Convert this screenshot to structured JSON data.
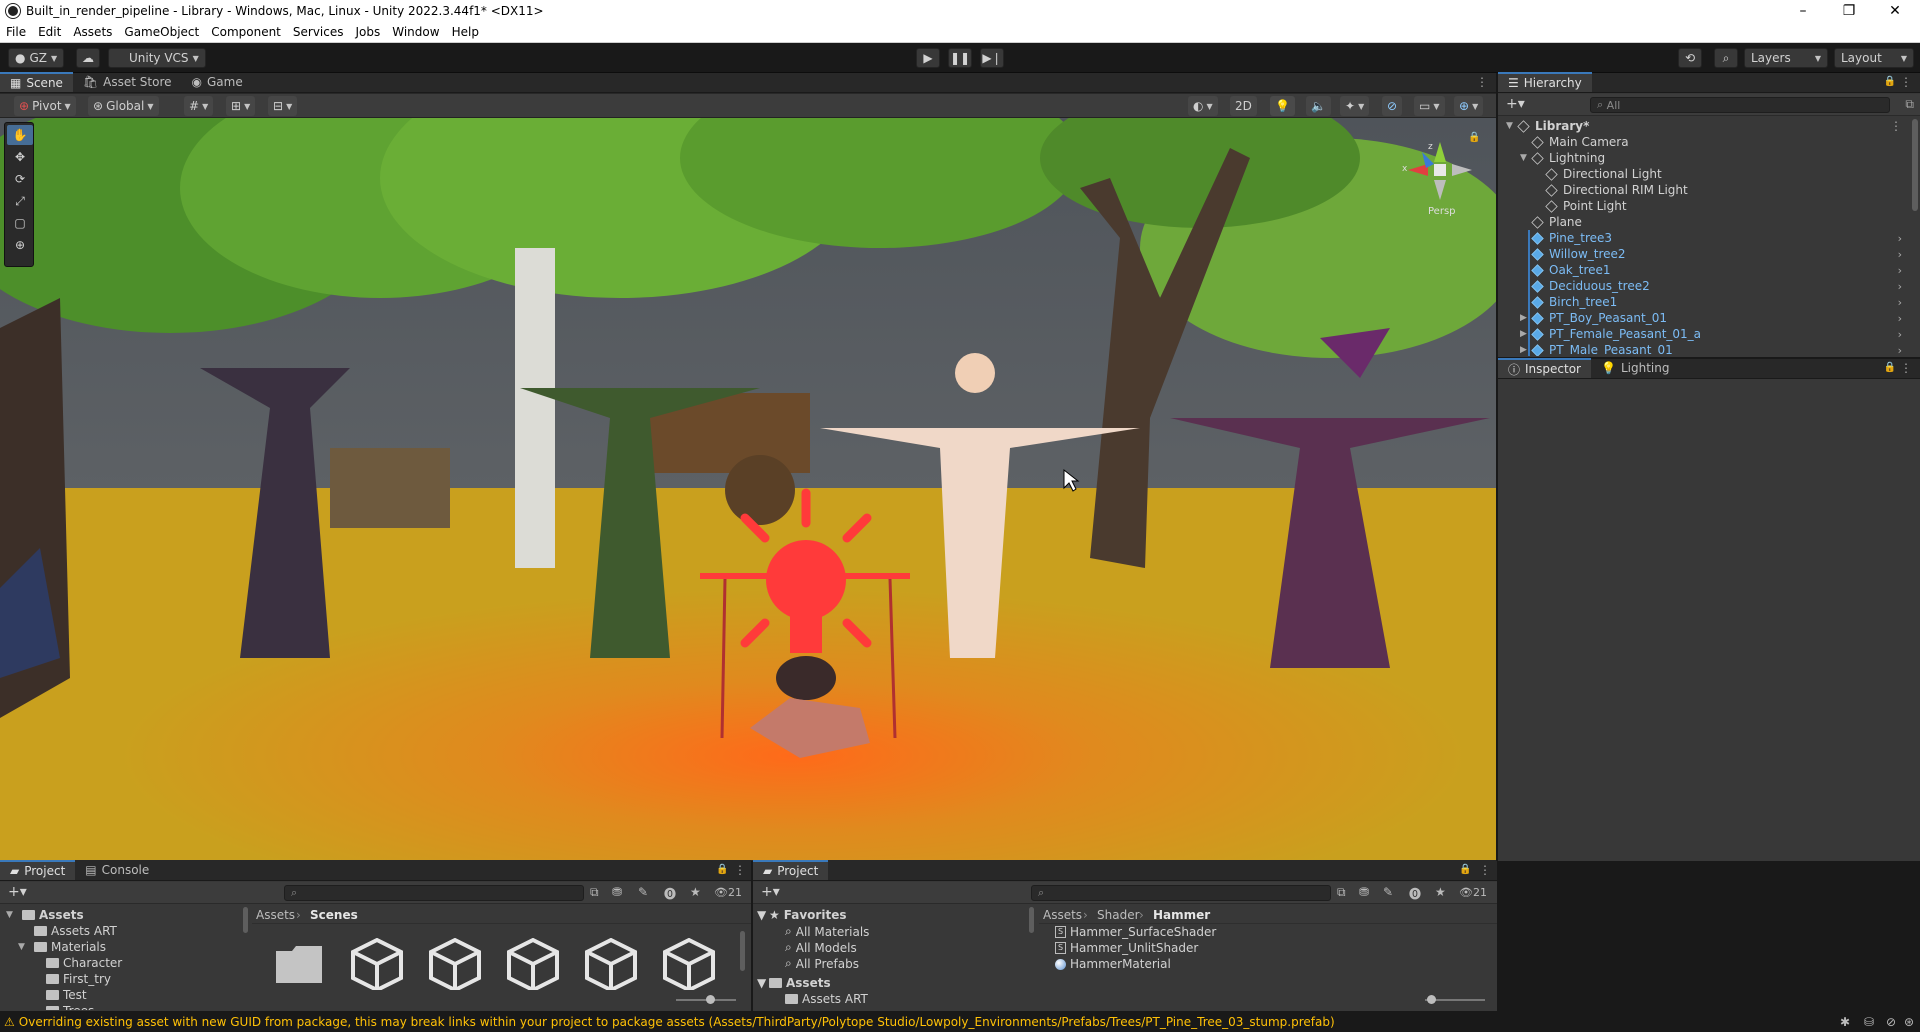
{
  "window": {
    "title": "Built_in_render_pipeline - Library - Windows, Mac, Linux - Unity 2022.3.44f1* <DX11>",
    "minimize": "–",
    "maximize": "❐",
    "close": "✕"
  },
  "menu": [
    "File",
    "Edit",
    "Assets",
    "GameObject",
    "Component",
    "Services",
    "Jobs",
    "Window",
    "Help"
  ],
  "toolbar": {
    "account": "GZ",
    "vcs": "Unity VCS",
    "layers": "Layers",
    "layout": "Layout"
  },
  "scene_tabs": [
    {
      "label": "Scene",
      "icon": "scene-icon"
    },
    {
      "label": "Asset Store",
      "icon": "store-icon"
    },
    {
      "label": "Game",
      "icon": "game-icon"
    }
  ],
  "scene_toolbar": {
    "pivot": "Pivot",
    "global": "Global",
    "mode_2d": "2D"
  },
  "gizmo": {
    "label": "Persp",
    "x": "x",
    "z": "z"
  },
  "hierarchy": {
    "tab": "Hierarchy",
    "search_placeholder": "All",
    "items": [
      {
        "label": "Library*",
        "depth": 0,
        "bold": true,
        "prefab": false,
        "expander": "open"
      },
      {
        "label": "Main Camera",
        "depth": 1,
        "prefab": false,
        "expander": ""
      },
      {
        "label": "Lightning",
        "depth": 1,
        "prefab": false,
        "expander": "open"
      },
      {
        "label": "Directional Light",
        "depth": 2,
        "prefab": false,
        "expander": ""
      },
      {
        "label": "Directional RIM Light",
        "depth": 2,
        "prefab": false,
        "expander": ""
      },
      {
        "label": "Point Light",
        "depth": 2,
        "prefab": false,
        "expander": ""
      },
      {
        "label": "Plane",
        "depth": 1,
        "prefab": false,
        "expander": ""
      },
      {
        "label": "Pine_tree3",
        "depth": 1,
        "prefab": true,
        "expander": ""
      },
      {
        "label": "Willow_tree2",
        "depth": 1,
        "prefab": true,
        "expander": ""
      },
      {
        "label": "Oak_tree1",
        "depth": 1,
        "prefab": true,
        "expander": ""
      },
      {
        "label": "Deciduous_tree2",
        "depth": 1,
        "prefab": true,
        "expander": ""
      },
      {
        "label": "Birch_tree1",
        "depth": 1,
        "prefab": true,
        "expander": ""
      },
      {
        "label": "PT_Boy_Peasant_01",
        "depth": 1,
        "prefab": true,
        "expander": "closed"
      },
      {
        "label": "PT_Female_Peasant_01_a",
        "depth": 1,
        "prefab": true,
        "expander": "closed"
      },
      {
        "label": "PT_Male_Peasant_01",
        "depth": 1,
        "prefab": true,
        "expander": "closed"
      }
    ]
  },
  "inspector_tabs": [
    {
      "label": "Inspector",
      "icon": "info-icon"
    },
    {
      "label": "Lighting",
      "icon": "bulb-icon"
    }
  ],
  "project_left": {
    "tabs": [
      {
        "label": "Project",
        "icon": "folder-icon"
      },
      {
        "label": "Console",
        "icon": "console-icon"
      }
    ],
    "count": "21",
    "tree": [
      {
        "label": "Assets",
        "depth": 0,
        "bold": true,
        "expander": "open"
      },
      {
        "label": "Assets ART",
        "depth": 1,
        "bold": false,
        "expander": ""
      },
      {
        "label": "Materials",
        "depth": 1,
        "bold": false,
        "expander": "open"
      },
      {
        "label": "Character",
        "depth": 2,
        "bold": false,
        "expander": ""
      },
      {
        "label": "First_try",
        "depth": 2,
        "bold": false,
        "expander": ""
      },
      {
        "label": "Test",
        "depth": 2,
        "bold": false,
        "expander": ""
      },
      {
        "label": "Trees",
        "depth": 2,
        "bold": false,
        "expander": ""
      }
    ],
    "breadcrumb": [
      "Assets",
      "Scenes"
    ]
  },
  "project_right": {
    "tab": "Project",
    "count": "21",
    "favorites": {
      "label": "Favorites",
      "items": [
        "All Materials",
        "All Models",
        "All Prefabs"
      ]
    },
    "assets_tree": [
      "Assets",
      "Assets ART"
    ],
    "breadcrumb": [
      "Assets",
      "Shader",
      "Hammer"
    ],
    "files": [
      {
        "label": "Hammer_SurfaceShader",
        "icon": "shader-icon"
      },
      {
        "label": "Hammer_UnlitShader",
        "icon": "shader-icon"
      },
      {
        "label": "HammerMaterial",
        "icon": "material-icon"
      }
    ]
  },
  "status": {
    "message": "Overriding existing asset with new GUID from package, this may break links within your project to package assets (Assets/ThirdParty/Polytope Studio/Lowpoly_Environments/Prefabs/Trees/PT_Pine_Tree_03_stump.prefab)"
  },
  "colors": {
    "editor_bg": "#383838",
    "toolbar_bg": "#191919",
    "selection": "#3a79bb",
    "prefab_text": "#7cbcf5",
    "warning": "#ffc107",
    "ground": "#c9a01e",
    "sky": "#5a5f66"
  }
}
